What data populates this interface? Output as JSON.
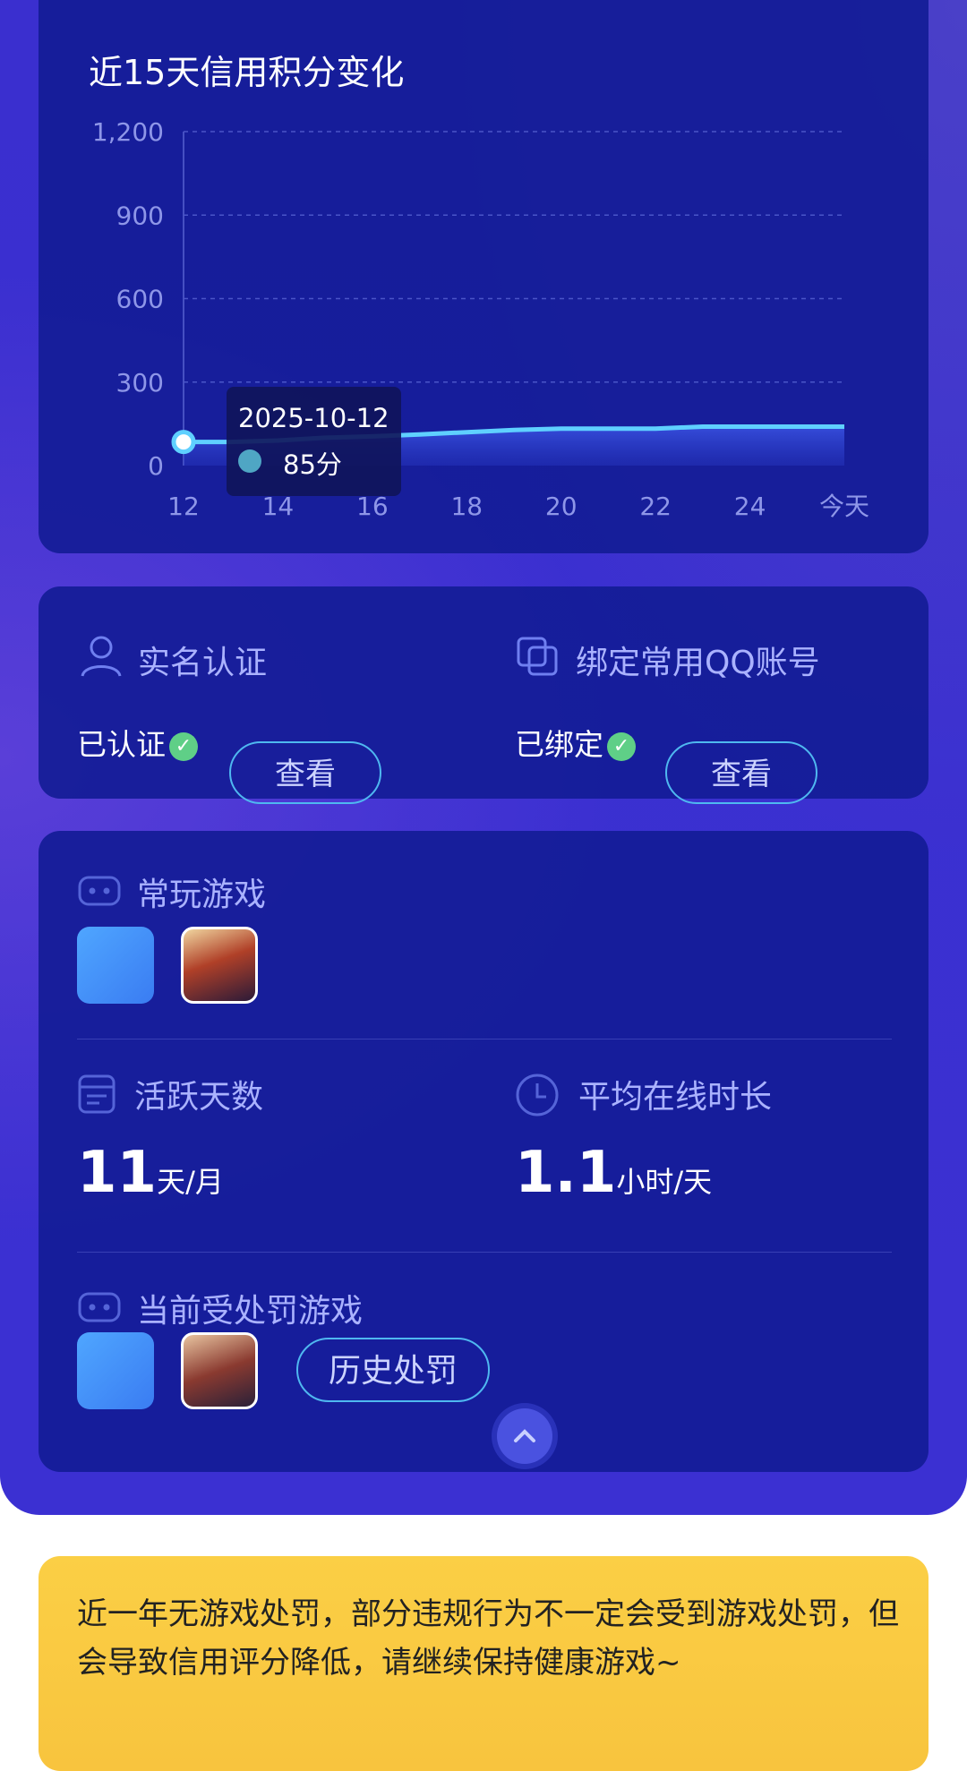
{
  "chart_card": {
    "title": "近15天信用积分变化",
    "tooltip": {
      "date": "2025-10-12",
      "value": "85分"
    }
  },
  "chart_data": {
    "type": "area",
    "title": "近15天信用积分变化",
    "x_tick_labels": [
      "12",
      "14",
      "16",
      "18",
      "20",
      "22",
      "24",
      "今天"
    ],
    "x": [
      12,
      13,
      14,
      15,
      16,
      17,
      18,
      19,
      20,
      21,
      22,
      23,
      24,
      25,
      26
    ],
    "series": [
      {
        "values": [
          85,
          85,
          90,
          100,
          105,
          112,
          120,
          128,
          133,
          133,
          133,
          140,
          140,
          140,
          140
        ]
      }
    ],
    "y_ticks": [
      0,
      300,
      600,
      900,
      1200
    ],
    "y_tick_labels": [
      "0",
      "300",
      "600",
      "900",
      "1,200"
    ],
    "ylim": [
      0,
      1200
    ],
    "xlim": [
      12,
      26
    ],
    "grid": true,
    "highlight_index": 0,
    "colors": {
      "line": "#5fd0ff",
      "area": "#3b55e6"
    }
  },
  "cert_card": {
    "realname": {
      "label": "实名认证",
      "status": "已认证",
      "button": "查看",
      "icon": "user-icon"
    },
    "qq": {
      "label": "绑定常用QQ账号",
      "status": "已绑定",
      "button": "查看",
      "icon": "link-accounts-icon"
    }
  },
  "games_card": {
    "frequent": {
      "label": "常玩游戏",
      "icon": "gamepad-icon",
      "games": [
        "blue-gamepad-app",
        "hero-game-app"
      ]
    },
    "active_days": {
      "label": "活跃天数",
      "value": "11",
      "unit": "天/月",
      "icon": "calendar-icon"
    },
    "avg_online": {
      "label": "平均在线时长",
      "value": "1.1",
      "unit": "小时/天",
      "icon": "clock-icon"
    },
    "punished": {
      "label": "当前受处罚游戏",
      "icon": "gamepad-icon",
      "button": "历史处罚",
      "games": [
        "blue-gamepad-app",
        "warrior-game-app"
      ]
    },
    "collapse_icon": "chevron-up-icon"
  },
  "notice": {
    "text": "近一年无游戏处罚，部分违规行为不一定会受到游戏处罚，但会导致信用评分降低，请继续保持健康游戏~"
  }
}
